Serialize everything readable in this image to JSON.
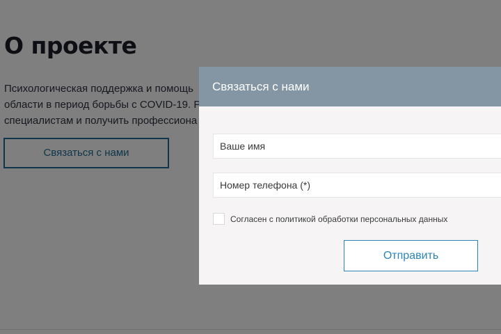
{
  "page": {
    "title": "О проекте",
    "intro_lines": [
      "Психологическая поддержка и помощь",
      "области в период борьбы с COVID-19. Р",
      "специалистам и получить профессиона"
    ],
    "contact_button": "Связаться с нами"
  },
  "modal": {
    "title": "Связаться с нами",
    "name_placeholder": "Ваше имя",
    "phone_placeholder": "Номер телефона (*)",
    "consent_label": "Согласен с политикой обработки персональных данных",
    "consent_checked": false,
    "submit_label": "Отправить"
  },
  "colors": {
    "overlay": "rgba(0,0,0,0.5)",
    "modal_header": "#8495a3",
    "accent": "#2b84b6",
    "modal_body": "#f6f4f4"
  }
}
